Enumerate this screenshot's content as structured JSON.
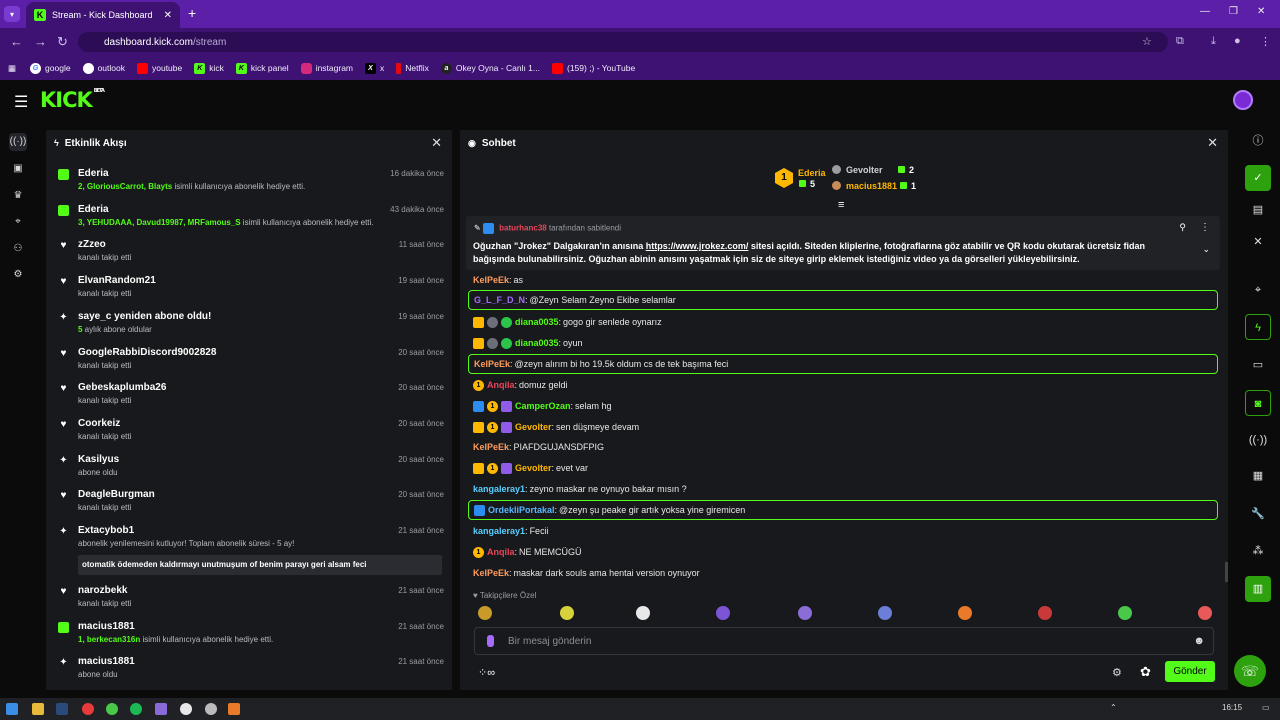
{
  "browser": {
    "tab_title": "Stream - Kick Dashboard",
    "url_host": "dashboard.kick.com",
    "url_path": "/stream",
    "bookmarks": [
      "google",
      "outlook",
      "youtube",
      "kick",
      "kick panel",
      "instagram",
      "x",
      "Netflix",
      "Okey Oyna - Canlı 1...",
      "(159) ;) - YouTube"
    ]
  },
  "app": {
    "logo": "KICK",
    "logo_tag": "BETA"
  },
  "activity": {
    "title": "Etkinlik Akışı",
    "events": [
      {
        "name": "Ederia",
        "time": "16 dakika önce",
        "sub_hl": "2, GloriousCarrot, Blayts",
        "sub": " isimli kullanıcıya abonelik hediye etti.",
        "type": "gift"
      },
      {
        "name": "Ederia",
        "time": "43 dakika önce",
        "sub_hl": "3, YEHUDAAA, Davud19987, MRFamous_S",
        "sub": " isimli kullanıcıya abonelik hediye etti.",
        "type": "gift"
      },
      {
        "name": "zZzeo",
        "time": "11 saat önce",
        "sub_hl": "",
        "sub": "kanalı takip etti",
        "type": "heart"
      },
      {
        "name": "ElvanRandom21",
        "time": "19 saat önce",
        "sub_hl": "",
        "sub": "kanalı takip etti",
        "type": "heart"
      },
      {
        "name": "saye_c yeniden abone oldu!",
        "time": "19 saat önce",
        "sub_hl": "5",
        "sub": " aylık abone oldular",
        "type": "star"
      },
      {
        "name": "GoogleRabbiDiscord9002828",
        "time": "20 saat önce",
        "sub_hl": "",
        "sub": "kanalı takip etti",
        "type": "heart"
      },
      {
        "name": "Gebeskaplumba26",
        "time": "20 saat önce",
        "sub_hl": "",
        "sub": "kanalı takip etti",
        "type": "heart"
      },
      {
        "name": "Coorkeiz",
        "time": "20 saat önce",
        "sub_hl": "",
        "sub": "kanalı takip etti",
        "type": "heart"
      },
      {
        "name": "Kasilyus",
        "time": "20 saat önce",
        "sub_hl": "",
        "sub": "abone oldu",
        "type": "star"
      },
      {
        "name": "DeagleBurgman",
        "time": "20 saat önce",
        "sub_hl": "",
        "sub": "kanalı takip etti",
        "type": "heart"
      },
      {
        "name": "Extacybob1",
        "time": "21 saat önce",
        "sub_hl": "",
        "sub": "abonelik yenilemesini kutluyor! Toplam abonelik süresi - 5 ay!",
        "type": "star",
        "message": "otomatik ödemeden kaldırmayı unutmuşum of benim parayı geri alsam feci"
      },
      {
        "name": "narozbekk",
        "time": "21 saat önce",
        "sub_hl": "",
        "sub": "kanalı takip etti",
        "type": "heart"
      },
      {
        "name": "macius1881",
        "time": "21 saat önce",
        "sub_hl": "1, berkecan316n",
        "sub": " isimli kullanıcıya abonelik hediye etti.",
        "type": "gift"
      },
      {
        "name": "macius1881",
        "time": "21 saat önce",
        "sub_hl": "",
        "sub": "abone oldu",
        "type": "star"
      }
    ]
  },
  "chat": {
    "title": "Sohbet",
    "leaderboard": [
      {
        "rank": "1",
        "name": "Ederia",
        "count": "5"
      },
      {
        "rank": "",
        "name": "Gevolter",
        "count": "2"
      },
      {
        "rank": "",
        "name": "macius1881",
        "count": "1"
      }
    ],
    "pinned": {
      "by_user": "baturhanc38",
      "by_text": " tarafından sabitlendi",
      "body_pre": "Oğuzhan \"Jrokez\" Dalgakıran'ın anısına ",
      "body_link": "https://www.jrokez.com/",
      "body_post": " sitesi açıldı. Siteden kliplerine, fotoğraflarına göz atabilir ve QR kodu okutarak ücretsiz fidan bağışında bulunabilirsiniz. Oğuzhan abinin anısını yaşatmak için siz de siteye girip eklemek istediğiniz video ya da görselleri yükleyebilirsiniz."
    },
    "messages": [
      {
        "user": "KelPeEk",
        "color": "#ff9d5c",
        "text": "as",
        "hl": false,
        "badges": []
      },
      {
        "user": "G_L_F_D_N",
        "color": "#a86bff",
        "text": "@Zeyn Selam Zeyno Ekibe selamlar",
        "hl": true,
        "badges": []
      },
      {
        "user": "diana0035",
        "color": "#53fc18",
        "text": "gogo gir senlede oynarız",
        "hl": false,
        "badges": [
          "crown",
          "ava",
          "green"
        ]
      },
      {
        "user": "diana0035",
        "color": "#53fc18",
        "text": "oyun",
        "hl": false,
        "badges": [
          "crown",
          "ava",
          "green"
        ]
      },
      {
        "user": "KelPeEk",
        "color": "#ff9d5c",
        "text": "@zeyn alırım bi ho 19.5k oldum cs de tek başıma feci",
        "hl": true,
        "badges": []
      },
      {
        "user": "Anqila",
        "color": "#e8455a",
        "text": "domuz geldi",
        "hl": false,
        "badges": [
          "one"
        ]
      },
      {
        "user": "CamperOzan",
        "color": "#53fc18",
        "text": "selam hg",
        "hl": false,
        "badges": [
          "blue",
          "one",
          "purple"
        ]
      },
      {
        "user": "Gevolter",
        "color": "#ffb800",
        "text": "sen düşmeye devam",
        "hl": false,
        "badges": [
          "crown",
          "one",
          "purple"
        ]
      },
      {
        "user": "KelPeEk",
        "color": "#ff9d5c",
        "text": "PIAFDGUJANSDFPIG",
        "hl": false,
        "badges": []
      },
      {
        "user": "Gevolter",
        "color": "#ffb800",
        "text": "evet var",
        "hl": false,
        "badges": [
          "crown",
          "one",
          "purple"
        ]
      },
      {
        "user": "kangaleray1",
        "color": "#57d0ff",
        "text": "zeyno maskar ne oynuyo bakar mısın ?",
        "hl": false,
        "badges": []
      },
      {
        "user": "OrdekliPortakal",
        "color": "#57b7ff",
        "text": "@zeyn şu peake gir artık yoksa yine giremicen",
        "hl": true,
        "badges": [
          "blue"
        ]
      },
      {
        "user": "kangaleray1",
        "color": "#57d0ff",
        "text": "Fecii",
        "hl": false,
        "badges": []
      },
      {
        "user": "Anqila",
        "color": "#e8455a",
        "text": "NE MEMCÜGÜ",
        "hl": false,
        "badges": [
          "one"
        ]
      },
      {
        "user": "KelPeEk",
        "color": "#ff9d5c",
        "text": "maskar dark souls ama hentai version oynuyor",
        "hl": false,
        "badges": []
      }
    ],
    "followers_label": "Takipçilere Özel",
    "input_placeholder": "Bir mesaj gönderin",
    "send_label": "Gönder"
  },
  "taskbar": {
    "time": "16:15"
  },
  "colors": {
    "brand": "#53fc18",
    "chrome": "#5b1fa8",
    "panel": "#18191c"
  }
}
